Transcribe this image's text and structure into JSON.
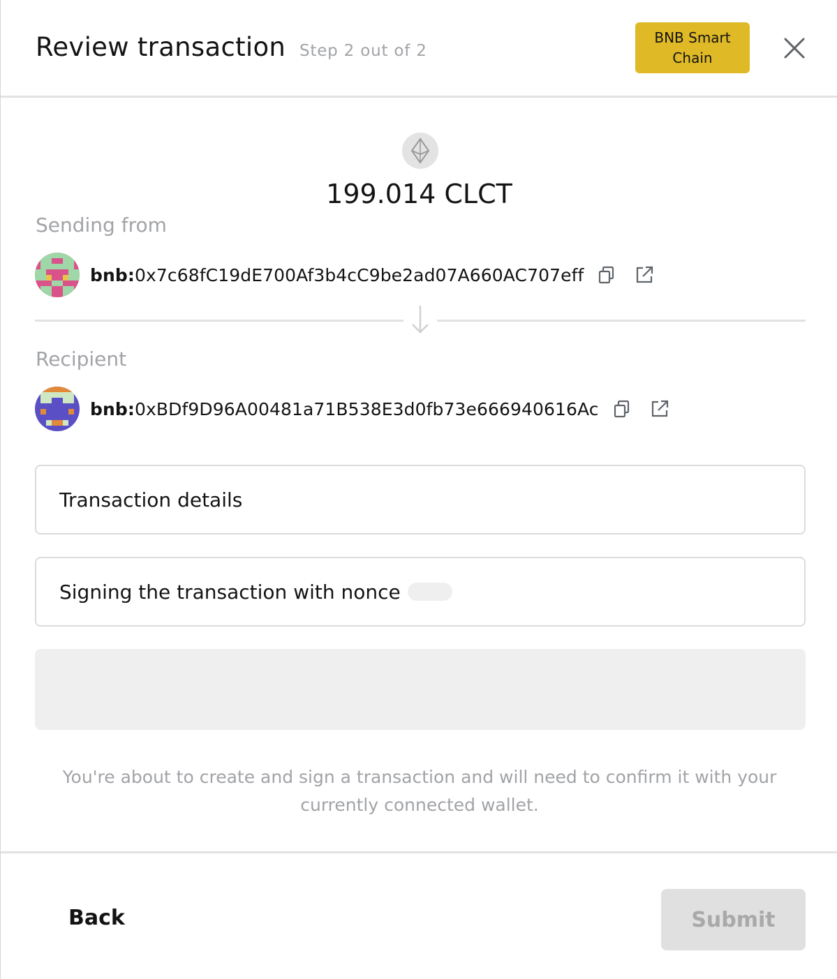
{
  "header": {
    "title": "Review transaction",
    "step": "Step 2 out of 2",
    "chain_badge": "BNB Smart Chain"
  },
  "token": {
    "icon": "ethereum-diamond-icon",
    "amount": "199.014 CLCT"
  },
  "sender": {
    "label": "Sending from",
    "prefix": "bnb:",
    "address": "0x7c68fC19dE700Af3b4cC9be2ad07A660AC707eff"
  },
  "recipient": {
    "label": "Recipient",
    "prefix": "bnb:",
    "address": "0xBDf9D96A00481a71B538E3d0fb73e666940616Ac"
  },
  "details": {
    "transaction_details": "Transaction details",
    "nonce_text": "Signing the transaction with nonce"
  },
  "notice": "You're about to create and sign a transaction and will need to confirm it with your currently connected wallet.",
  "footer": {
    "back_label": "Back",
    "submit_label": "Submit"
  },
  "colors": {
    "chain_badge": "#e0b927",
    "muted_text": "#a1a3a7",
    "submit_disabled_bg": "#e0e0e0"
  }
}
